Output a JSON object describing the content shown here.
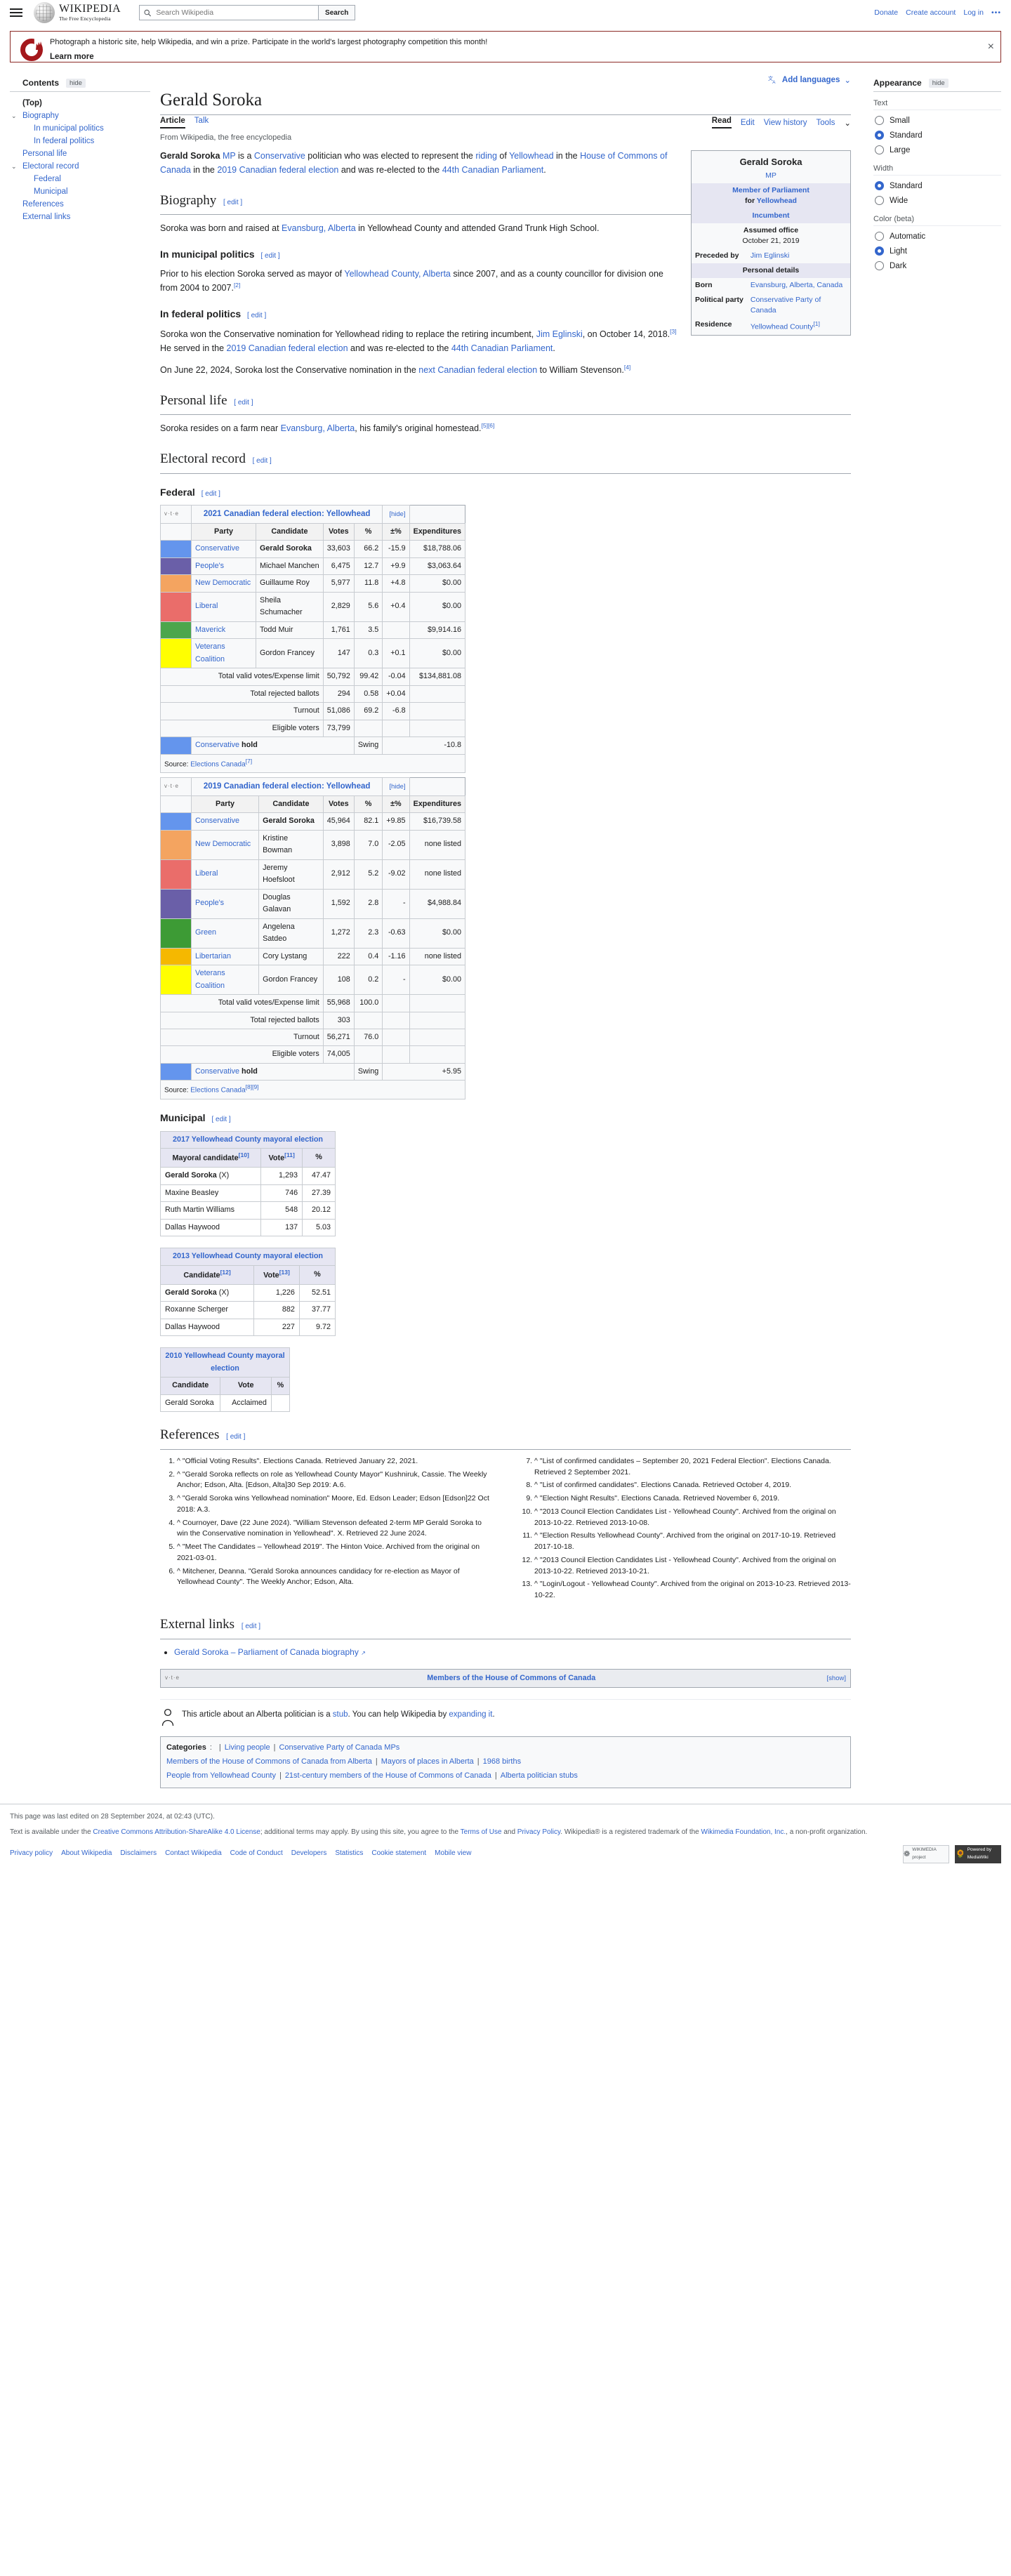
{
  "header": {
    "search_placeholder": "Search Wikipedia",
    "search_button": "Search",
    "wordmark": "WIKIPEDIA",
    "tagline": "The Free Encyclopedia",
    "links": [
      {
        "label": "Donate"
      },
      {
        "label": "Create account"
      },
      {
        "label": "Log in"
      }
    ],
    "more": "•••"
  },
  "banner": {
    "text": "Photograph a historic site, help Wikipedia, and win a prize. Participate in the world's largest photography competition this month!",
    "cta": "Learn more",
    "close": "×"
  },
  "toc": {
    "heading": "Contents",
    "hide": "hide",
    "items": [
      {
        "label": "(Top)",
        "level": 0,
        "chevron": false
      },
      {
        "label": "Biography",
        "level": 0,
        "chevron": true
      },
      {
        "label": "In municipal politics",
        "level": 1,
        "chevron": false
      },
      {
        "label": "In federal politics",
        "level": 1,
        "chevron": false
      },
      {
        "label": "Personal life",
        "level": 0,
        "chevron": false
      },
      {
        "label": "Electoral record",
        "level": 0,
        "chevron": true
      },
      {
        "label": "Federal",
        "level": 1,
        "chevron": false
      },
      {
        "label": "Municipal",
        "level": 1,
        "chevron": false
      },
      {
        "label": "References",
        "level": 0,
        "chevron": false
      },
      {
        "label": "External links",
        "level": 0,
        "chevron": false
      }
    ]
  },
  "article": {
    "add_languages": "Add languages",
    "title": "Gerald Soroka",
    "tabs_left": [
      {
        "label": "Article",
        "active": true
      },
      {
        "label": "Talk",
        "active": false
      }
    ],
    "tabs_right": [
      {
        "label": "Read"
      },
      {
        "label": "Edit"
      },
      {
        "label": "View history"
      },
      {
        "label": "Tools"
      }
    ],
    "subtitle": "From Wikipedia, the free encyclopedia",
    "edit": "[ edit ]"
  },
  "infobox": {
    "name": "Gerald Soroka",
    "post_nominal": "MP",
    "office_line1": "Member of Parliament",
    "office_line2_pre": "for ",
    "office_line2": "Yellowhead",
    "incumbent": "Incumbent",
    "assumed_label": "Assumed office",
    "assumed_date": "October 21, 2019",
    "preceded_label": "Preceded by",
    "preceded_value": "Jim Eglinski",
    "personal_details": "Personal details",
    "rows": [
      {
        "label": "Born",
        "value": "Evansburg, Alberta, Canada",
        "link": true
      },
      {
        "label": "Political party",
        "value": "Conservative Party of Canada",
        "link": true
      },
      {
        "label": "Residence",
        "value": "Yellowhead County",
        "link": true,
        "sup": "[1]"
      }
    ]
  },
  "lead": {
    "p1_parts": [
      {
        "t": "Gerald Soroka",
        "b": true
      },
      {
        "t": " "
      },
      {
        "t": "MP",
        "l": true
      },
      {
        "t": " is a "
      },
      {
        "t": "Conservative",
        "l": true
      },
      {
        "t": " politician who was elected to represent the "
      },
      {
        "t": "riding",
        "l": true
      },
      {
        "t": " of "
      },
      {
        "t": "Yellowhead",
        "l": true
      },
      {
        "t": " in the "
      },
      {
        "t": "House of Commons of Canada",
        "l": true
      },
      {
        "t": " in the "
      },
      {
        "t": "2019 Canadian federal election",
        "l": true
      },
      {
        "t": " and was re-elected to the "
      },
      {
        "t": "44th Canadian Parliament",
        "l": true
      },
      {
        "t": "."
      }
    ]
  },
  "sections": {
    "biography": "Biography",
    "biography_p": [
      {
        "t": "Soroka was born and raised at "
      },
      {
        "t": "Evansburg, Alberta",
        "l": true
      },
      {
        "t": " in Yellowhead County and attended Grand Trunk High School."
      }
    ],
    "municipal_politics": "In municipal politics",
    "municipal_p": [
      {
        "t": "Prior to his election Soroka served as mayor of "
      },
      {
        "t": "Yellowhead County, Alberta",
        "l": true
      },
      {
        "t": " since 2007, and as a county councillor for division one from 2004 to 2007."
      },
      {
        "t": "[2]",
        "s": true
      }
    ],
    "federal_politics": "In federal politics",
    "federal_p1": [
      {
        "t": "Soroka won the Conservative nomination for Yellowhead riding to replace the retiring incumbent, "
      },
      {
        "t": "Jim Eglinski",
        "l": true
      },
      {
        "t": ", on October 14, 2018."
      },
      {
        "t": "[3]",
        "s": true
      },
      {
        "t": " He served in the "
      },
      {
        "t": "2019 Canadian federal election",
        "l": true
      },
      {
        "t": " and was re-elected to the "
      },
      {
        "t": "44th Canadian Parliament",
        "l": true
      },
      {
        "t": "."
      }
    ],
    "federal_p2": [
      {
        "t": "On June 22, 2024, Soroka lost the Conservative nomination in the "
      },
      {
        "t": "next Canadian federal election",
        "l": true
      },
      {
        "t": " to William Stevenson."
      },
      {
        "t": "[4]",
        "s": true
      }
    ],
    "personal_life": "Personal life",
    "personal_p": [
      {
        "t": "Soroka resides on a farm near "
      },
      {
        "t": "Evansburg, Alberta",
        "l": true
      },
      {
        "t": ", his family's original homestead."
      },
      {
        "t": "[5][6]",
        "s": true
      }
    ],
    "electoral_record": "Electoral record",
    "federal": "Federal",
    "municipal": "Municipal",
    "references": "References",
    "external_links": "External links"
  },
  "election_2021": {
    "vte": "v·t·e",
    "title": "2021 Canadian federal election: Yellowhead",
    "toggle": "[hide]",
    "columns": [
      "Party",
      "Candidate",
      "Votes",
      "%",
      "±%",
      "Expenditures"
    ],
    "rows": [
      {
        "color": "#6495ed",
        "party": "Conservative",
        "candidate": "Gerald Soroka",
        "votes": "33,603",
        "pct": "66.2",
        "swing": "-15.9",
        "exp": "$18,788.06",
        "winner": true
      },
      {
        "color": "#6a5fa8",
        "party": "People's",
        "candidate": "Michael Manchen",
        "votes": "6,475",
        "pct": "12.7",
        "swing": "+9.9",
        "exp": "$3,063.64"
      },
      {
        "color": "#f4a460",
        "party": "New Democratic",
        "candidate": "Guillaume Roy",
        "votes": "5,977",
        "pct": "11.8",
        "swing": "+4.8",
        "exp": "$0.00"
      },
      {
        "color": "#ea6d6a",
        "party": "Liberal",
        "candidate": "Sheila Schumacher",
        "votes": "2,829",
        "pct": "5.6",
        "swing": "+0.4",
        "exp": "$0.00"
      },
      {
        "color": "#4ca64c",
        "party": "Maverick",
        "candidate": "Todd Muir",
        "votes": "1,761",
        "pct": "3.5",
        "swing": "",
        "exp": "$9,914.16"
      },
      {
        "color": "#ffff00",
        "party": "Veterans Coalition",
        "candidate": "Gordon Francey",
        "votes": "147",
        "pct": "0.3",
        "swing": "+0.1",
        "exp": "$0.00"
      }
    ],
    "totals": [
      {
        "label": "Total valid votes/Expense limit",
        "votes": "50,792",
        "pct": "99.42",
        "swing": "-0.04",
        "exp": "$134,881.08"
      },
      {
        "label": "Total rejected ballots",
        "votes": "294",
        "pct": "0.58",
        "swing": "+0.04",
        "exp": ""
      },
      {
        "label": "Turnout",
        "votes": "51,086",
        "pct": "69.2",
        "swing": "-6.8",
        "exp": ""
      },
      {
        "label": "Eligible voters",
        "votes": "73,799",
        "pct": "",
        "swing": "",
        "exp": ""
      }
    ],
    "hold_color": "#6495ed",
    "hold_party": "Conservative",
    "hold_text": "hold",
    "swing_label": "Swing",
    "swing_value": "-10.8",
    "source_label": "Source: ",
    "source_link": "Elections Canada",
    "source_sup": "[7]"
  },
  "election_2019": {
    "vte": "v·t·e",
    "title": "2019 Canadian federal election: Yellowhead",
    "toggle": "[hide]",
    "columns": [
      "Party",
      "Candidate",
      "Votes",
      "%",
      "±%",
      "Expenditures"
    ],
    "rows": [
      {
        "color": "#6495ed",
        "party": "Conservative",
        "candidate": "Gerald Soroka",
        "votes": "45,964",
        "pct": "82.1",
        "swing": "+9.85",
        "exp": "$16,739.58",
        "winner": true
      },
      {
        "color": "#f4a460",
        "party": "New Democratic",
        "candidate": "Kristine Bowman",
        "votes": "3,898",
        "pct": "7.0",
        "swing": "-2.05",
        "exp": "none listed"
      },
      {
        "color": "#ea6d6a",
        "party": "Liberal",
        "candidate": "Jeremy Hoefsloot",
        "votes": "2,912",
        "pct": "5.2",
        "swing": "-9.02",
        "exp": "none listed"
      },
      {
        "color": "#6a5fa8",
        "party": "People's",
        "candidate": "Douglas Galavan",
        "votes": "1,592",
        "pct": "2.8",
        "swing": "-",
        "exp": "$4,988.84"
      },
      {
        "color": "#3d9b35",
        "party": "Green",
        "candidate": "Angelena Satdeo",
        "votes": "1,272",
        "pct": "2.3",
        "swing": "-0.63",
        "exp": "$0.00"
      },
      {
        "color": "#f5b800",
        "party": "Libertarian",
        "candidate": "Cory Lystang",
        "votes": "222",
        "pct": "0.4",
        "swing": "-1.16",
        "exp": "none listed"
      },
      {
        "color": "#ffff00",
        "party": "Veterans Coalition",
        "candidate": "Gordon Francey",
        "votes": "108",
        "pct": "0.2",
        "swing": "-",
        "exp": "$0.00"
      }
    ],
    "totals": [
      {
        "label": "Total valid votes/Expense limit",
        "votes": "55,968",
        "pct": "100.0",
        "swing": "",
        "exp": ""
      },
      {
        "label": "Total rejected ballots",
        "votes": "303",
        "pct": "",
        "swing": "",
        "exp": ""
      },
      {
        "label": "Turnout",
        "votes": "56,271",
        "pct": "76.0",
        "swing": "",
        "exp": ""
      },
      {
        "label": "Eligible voters",
        "votes": "74,005",
        "pct": "",
        "swing": "",
        "exp": ""
      }
    ],
    "hold_color": "#6495ed",
    "hold_party": "Conservative",
    "hold_text": "hold",
    "swing_label": "Swing",
    "swing_value": "+5.95",
    "source_label": "Source: ",
    "source_link": "Elections Canada",
    "source_sup": "[8][9]"
  },
  "mayoral_2017": {
    "title": "2017 Yellowhead County mayoral election",
    "columns": [
      "Mayoral candidate",
      "Vote",
      "%"
    ],
    "col_sup": [
      "[10]",
      "[11]",
      ""
    ],
    "rows": [
      {
        "name": "Gerald Soroka",
        "suffix": " (X)",
        "bold": true,
        "vote": "1,293",
        "pct": "47.47"
      },
      {
        "name": "Maxine Beasley",
        "suffix": "",
        "bold": false,
        "vote": "746",
        "pct": "27.39"
      },
      {
        "name": "Ruth Martin Williams",
        "suffix": "",
        "bold": false,
        "vote": "548",
        "pct": "20.12"
      },
      {
        "name": "Dallas Haywood",
        "suffix": "",
        "bold": false,
        "vote": "137",
        "pct": "5.03"
      }
    ]
  },
  "mayoral_2013": {
    "title": "2013 Yellowhead County mayoral election",
    "columns": [
      "Candidate",
      "Vote",
      "%"
    ],
    "col_sup": [
      "[12]",
      "[13]",
      ""
    ],
    "rows": [
      {
        "name": "Gerald Soroka",
        "suffix": " (X)",
        "bold": true,
        "vote": "1,226",
        "pct": "52.51"
      },
      {
        "name": "Roxanne Scherger",
        "suffix": "",
        "bold": false,
        "vote": "882",
        "pct": "37.77"
      },
      {
        "name": "Dallas Haywood",
        "suffix": "",
        "bold": false,
        "vote": "227",
        "pct": "9.72"
      }
    ]
  },
  "mayoral_2010": {
    "title": "2010 Yellowhead County mayoral election",
    "columns": [
      "Candidate",
      "Vote",
      "%"
    ],
    "rows": [
      {
        "name": "Gerald Soroka",
        "suffix": "",
        "bold": false,
        "vote": "Acclaimed",
        "pct": ""
      }
    ]
  },
  "references": {
    "left": [
      "^ \"Official Voting Results\". Elections Canada. Retrieved January 22, 2021.",
      "^ \"Gerald Soroka reflects on role as Yellowhead County Mayor\" Kushniruk, Cassie. The Weekly Anchor; Edson, Alta. [Edson, Alta]30 Sep 2019: A.6.",
      "^ \"Gerald Soroka wins Yellowhead nomination\" Moore, Ed. Edson Leader; Edson [Edson]22 Oct 2018: A.3.",
      "^ Cournoyer, Dave (22 June 2024). \"William Stevenson defeated 2-term MP Gerald Soroka to win the Conservative nomination in Yellowhead\". X. Retrieved 22 June 2024.",
      "^ \"Meet The Candidates – Yellowhead 2019\". The Hinton Voice. Archived from the original on 2021-03-01.",
      "^ Mitchener, Deanna. \"Gerald Soroka announces candidacy for re-election as Mayor of Yellowhead County\". The Weekly Anchor; Edson, Alta."
    ],
    "right": [
      "^ \"List of confirmed candidates – September 20, 2021 Federal Election\". Elections Canada. Retrieved 2 September 2021.",
      "^ \"List of confirmed candidates\". Elections Canada. Retrieved October 4, 2019.",
      "^ \"Election Night Results\". Elections Canada. Retrieved November 6, 2019.",
      "^ \"2013 Council Election Candidates List - Yellowhead County\". Archived from the original on 2013-10-22. Retrieved 2013-10-08.",
      "^ \"Election Results Yellowhead County\". Archived from the original on 2017-10-19. Retrieved 2017-10-18.",
      "^ \"2013 Council Election Candidates List - Yellowhead County\". Archived from the original on 2013-10-22. Retrieved 2013-10-21.",
      "^ \"Login/Logout - Yellowhead County\". Archived from the original on 2013-10-23. Retrieved 2013-10-22."
    ],
    "ref_numbers_left": [
      "1.",
      "2.",
      "3.",
      "4.",
      "5.",
      "6."
    ],
    "ref_numbers_right": [
      "7.",
      "8.",
      "9.",
      "10.",
      "11.",
      "12.",
      "13."
    ]
  },
  "external_links": [
    "Gerald Soroka – Parliament of Canada biography"
  ],
  "navbox": {
    "vte": "v·t·e",
    "title": "Members of the House of Commons of Canada",
    "show": "[show]"
  },
  "stub": {
    "parts": [
      {
        "t": "This article about an Alberta politician is a "
      },
      {
        "t": "stub",
        "l": true
      },
      {
        "t": ". You can help Wikipedia by "
      },
      {
        "t": "expanding it",
        "l": true
      },
      {
        "t": "."
      }
    ]
  },
  "categories": {
    "label": "Categories",
    "line1": [
      "Living people",
      "Conservative Party of Canada MPs"
    ],
    "line2": [
      "Members of the House of Commons of Canada from Alberta",
      "Mayors of places in Alberta",
      "1968 births"
    ],
    "line3": [
      "People from Yellowhead County",
      "21st-century members of the House of Commons of Canada",
      "Alberta politician stubs"
    ]
  },
  "appearance": {
    "heading": "Appearance",
    "hide": "hide",
    "groups": [
      {
        "label": "Text",
        "options": [
          {
            "label": "Small",
            "selected": false
          },
          {
            "label": "Standard",
            "selected": true
          },
          {
            "label": "Large",
            "selected": false
          }
        ]
      },
      {
        "label": "Width",
        "options": [
          {
            "label": "Standard",
            "selected": true
          },
          {
            "label": "Wide",
            "selected": false
          }
        ]
      },
      {
        "label": "Color (beta)",
        "options": [
          {
            "label": "Automatic",
            "selected": false
          },
          {
            "label": "Light",
            "selected": true
          },
          {
            "label": "Dark",
            "selected": false
          }
        ]
      }
    ]
  },
  "footer": {
    "last_edited": "This page was last edited on 28 September 2024, at 02:43 (UTC).",
    "license_parts": [
      {
        "t": "Text is available under the "
      },
      {
        "t": "Creative Commons Attribution-ShareAlike 4.0 License",
        "l": true
      },
      {
        "t": "; additional terms may apply. By using this site, you agree to the "
      },
      {
        "t": "Terms of Use",
        "l": true
      },
      {
        "t": " and "
      },
      {
        "t": "Privacy Policy",
        "l": true
      },
      {
        "t": ". Wikipedia® is a registered trademark of the "
      },
      {
        "t": "Wikimedia Foundation, Inc.",
        "l": true
      },
      {
        "t": ", a non-profit organization."
      }
    ],
    "links": [
      "Privacy policy",
      "About Wikipedia",
      "Disclaimers",
      "Contact Wikipedia",
      "Code of Conduct",
      "Developers",
      "Statistics",
      "Cookie statement",
      "Mobile view"
    ],
    "badge1": "WIKIMEDIA project",
    "badge2": "Powered by MediaWiki"
  }
}
